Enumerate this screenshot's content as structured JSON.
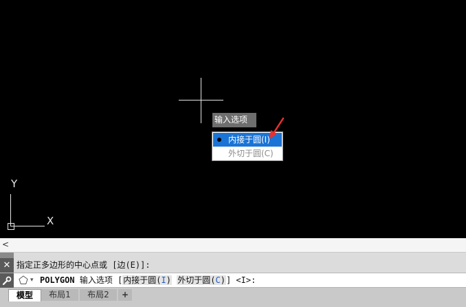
{
  "canvas": {
    "ucs_y_label": "Y",
    "ucs_x_label": "X"
  },
  "dynamic_input": {
    "title": "输入选项",
    "options": [
      {
        "label": "内接于圆(I)",
        "selected": true
      },
      {
        "label": "外切于圆(C)",
        "selected": false
      }
    ]
  },
  "command": {
    "history_chevron": "<",
    "close_glyph": "✕",
    "wrench_glyph": "🔧",
    "history_prompt": "指定正多边形的中心点或 [边(E)]:",
    "command_name": "POLYGON",
    "prompt_label": "输入选项",
    "bracket_open": "[",
    "option1_text": "内接于圆(",
    "option1_key": "I",
    "option2_text": "外切于圆(",
    "option2_key": "C",
    "paren_close": ")",
    "bracket_close": "]",
    "default": "<I>:"
  },
  "tabs": {
    "items": [
      "模型",
      "布局1",
      "布局2"
    ],
    "add": "+"
  },
  "colors": {
    "canvas_bg": "#000000",
    "menu_highlight": "#1a74d6",
    "arrow": "#e8312f",
    "hotkey": "#1e5ac8"
  }
}
